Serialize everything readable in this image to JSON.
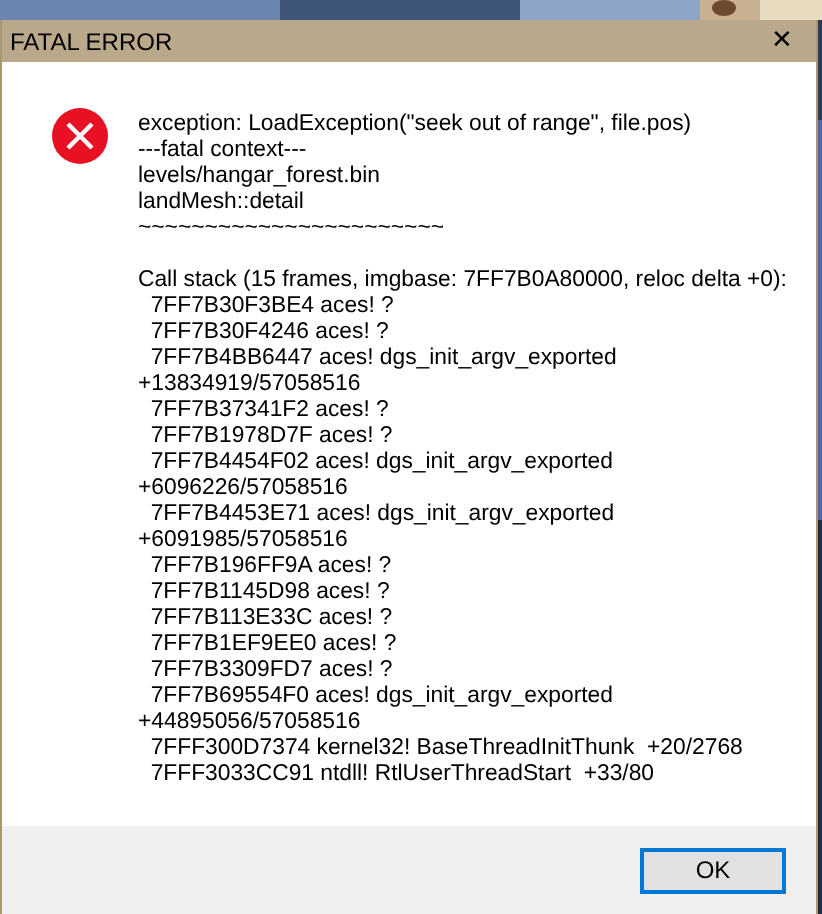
{
  "window": {
    "title": "FATAL ERROR",
    "close_glyph": "✕"
  },
  "message": {
    "paragraphs": [
      [
        "exception: LoadException(\"seek out of range\", file.pos)",
        "---fatal context---",
        "levels/hangar_forest.bin",
        "landMesh::detail",
        "~~~~~~~~~~~~~~~~~~~~~~~"
      ],
      [
        "Call stack (15 frames, imgbase: 7FF7B0A80000, reloc delta +0):",
        "  7FF7B30F3BE4 aces! ?",
        "  7FF7B30F4246 aces! ?",
        "  7FF7B4BB6447 aces! dgs_init_argv_exported",
        "+13834919/57058516",
        "  7FF7B37341F2 aces! ?",
        "  7FF7B1978D7F aces! ?",
        "  7FF7B4454F02 aces! dgs_init_argv_exported",
        "+6096226/57058516",
        "  7FF7B4453E71 aces! dgs_init_argv_exported",
        "+6091985/57058516",
        "  7FF7B196FF9A aces! ?",
        "  7FF7B1145D98 aces! ?",
        "  7FF7B113E33C aces! ?",
        "  7FF7B1EF9EE0 aces! ?",
        "  7FF7B3309FD7 aces! ?",
        "  7FF7B69554F0 aces! dgs_init_argv_exported",
        "+44895056/57058516",
        "  7FFF300D7374 kernel32! BaseThreadInitThunk  +20/2768",
        "  7FFF3033CC91 ntdll! RtlUserThreadStart  +33/80"
      ]
    ]
  },
  "buttons": [
    {
      "label": "OK",
      "focused": true
    }
  ]
}
